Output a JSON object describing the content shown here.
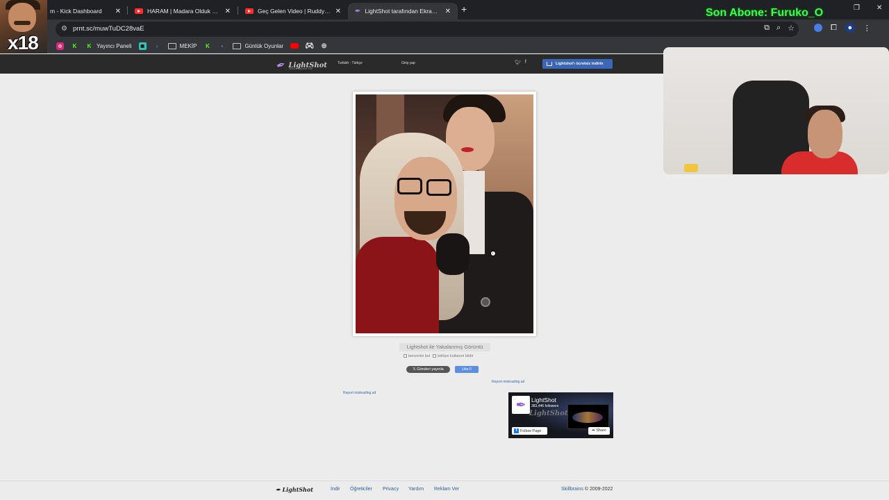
{
  "browser": {
    "tabs": [
      {
        "title": "m - Kick Dashboard",
        "icon": "kick-icon",
        "active": false
      },
      {
        "title": "HARAM | Madara Olduk #580 -",
        "icon": "youtube-icon",
        "active": false
      },
      {
        "title": "Geç Gelen Video | Ruddy - You",
        "icon": "youtube-icon",
        "active": false
      },
      {
        "title": "LightShot tarafından Ekran Gör",
        "icon": "lightshot-feather-icon",
        "active": true
      }
    ],
    "new_tab": "+",
    "url": "prnt.sc/muwTuDC28vaE",
    "bookmarks": [
      {
        "label": "",
        "icon": "x-icon"
      },
      {
        "label": "",
        "icon": "instagram-icon"
      },
      {
        "label": "",
        "icon": "kick-icon"
      },
      {
        "label": "Yayıncı Paneli",
        "icon": "kick-icon"
      },
      {
        "label": "",
        "icon": "twitch-tools-icon"
      },
      {
        "label": "",
        "icon": "prime-icon"
      },
      {
        "label": "MEKİP",
        "icon": "folder-icon"
      },
      {
        "label": "",
        "icon": "kick-icon"
      },
      {
        "label": "",
        "icon": "blue-app-icon"
      },
      {
        "label": "Günlük Oyunlar",
        "icon": "folder-icon"
      },
      {
        "label": "",
        "icon": "youtube-icon"
      },
      {
        "label": "",
        "icon": "gamepad-icon"
      },
      {
        "label": "",
        "icon": "globe-icon"
      }
    ]
  },
  "stream_overlay": {
    "badge": "x18",
    "ticker": "Son Abone: Furuko_O"
  },
  "lightshot": {
    "logo": "LightShot",
    "tagline": "screen capture tool",
    "language": "Turkish - Türkçe",
    "login": "Giriş yap",
    "social": [
      "twitter-icon",
      "facebook-icon"
    ],
    "download_button": "Lightshot'ı ücretsiz indirin",
    "caption": "Lightshot ile Yakalanmış Görüntü",
    "find_similar": "benzerini bul",
    "report_abuse": "kötüye kullanım bildir",
    "tweet_button": "Gönderi yayınla",
    "like_button": "Like 0",
    "report_ad_1": "Report misleading ad",
    "report_ad_2": "Report misleading ad",
    "fb_widget": {
      "title": "LightShot",
      "followers": "383,446 followers",
      "watermark": "LightShot",
      "follow": "Follow Page",
      "share": "Share"
    },
    "footer": {
      "logo": "LightShot",
      "links": [
        "İndir",
        "Öğreticiler",
        "Privacy",
        "Yardım",
        "Reklam Ver"
      ],
      "copyright_brand": "Skillbrains",
      "copyright": "© 2009-2022"
    }
  },
  "colors": {
    "accent_blue": "#3c67b8",
    "overlay_green": "#39ff4b",
    "header_dark": "#2a2a2a"
  }
}
